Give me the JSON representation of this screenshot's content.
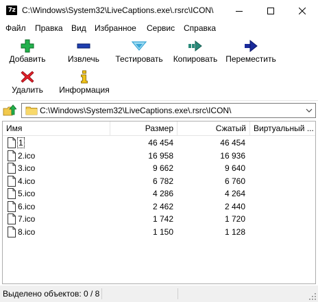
{
  "window": {
    "app_icon_text": "7z",
    "title": "C:\\Windows\\System32\\LiveCaptions.exe\\.rsrc\\ICON\\"
  },
  "menu": {
    "items": [
      "Файл",
      "Правка",
      "Вид",
      "Избранное",
      "Сервис",
      "Справка"
    ]
  },
  "toolbar": {
    "add": "Добавить",
    "extract": "Извлечь",
    "test": "Тестировать",
    "copy": "Копировать",
    "move": "Переместить",
    "delete": "Удалить",
    "info": "Информация"
  },
  "address": {
    "path": "C:\\Windows\\System32\\LiveCaptions.exe\\.rsrc\\ICON\\"
  },
  "list": {
    "columns": {
      "name": "Имя",
      "size": "Размер",
      "packed": "Сжатый",
      "virtual": "Виртуальный ..."
    },
    "rows": [
      {
        "name": "1",
        "size": "46 454",
        "packed": "46 454"
      },
      {
        "name": "2.ico",
        "size": "16 958",
        "packed": "16 936"
      },
      {
        "name": "3.ico",
        "size": "9 662",
        "packed": "9 640"
      },
      {
        "name": "4.ico",
        "size": "6 782",
        "packed": "6 760"
      },
      {
        "name": "5.ico",
        "size": "4 286",
        "packed": "4 264"
      },
      {
        "name": "6.ico",
        "size": "2 462",
        "packed": "2 440"
      },
      {
        "name": "7.ico",
        "size": "1 742",
        "packed": "1 720"
      },
      {
        "name": "8.ico",
        "size": "1 150",
        "packed": "1 128"
      }
    ]
  },
  "status": {
    "selected": "Выделено объектов: 0 / 8"
  },
  "colors": {
    "add_green": "#22b14c",
    "extract_blue": "#1f3fb0",
    "test_cyan": "#3aa6d6",
    "copy_teal": "#2a8a7a",
    "move_navy": "#1a2a9a",
    "delete_red": "#e0202a",
    "info_yellow": "#f0c419"
  }
}
